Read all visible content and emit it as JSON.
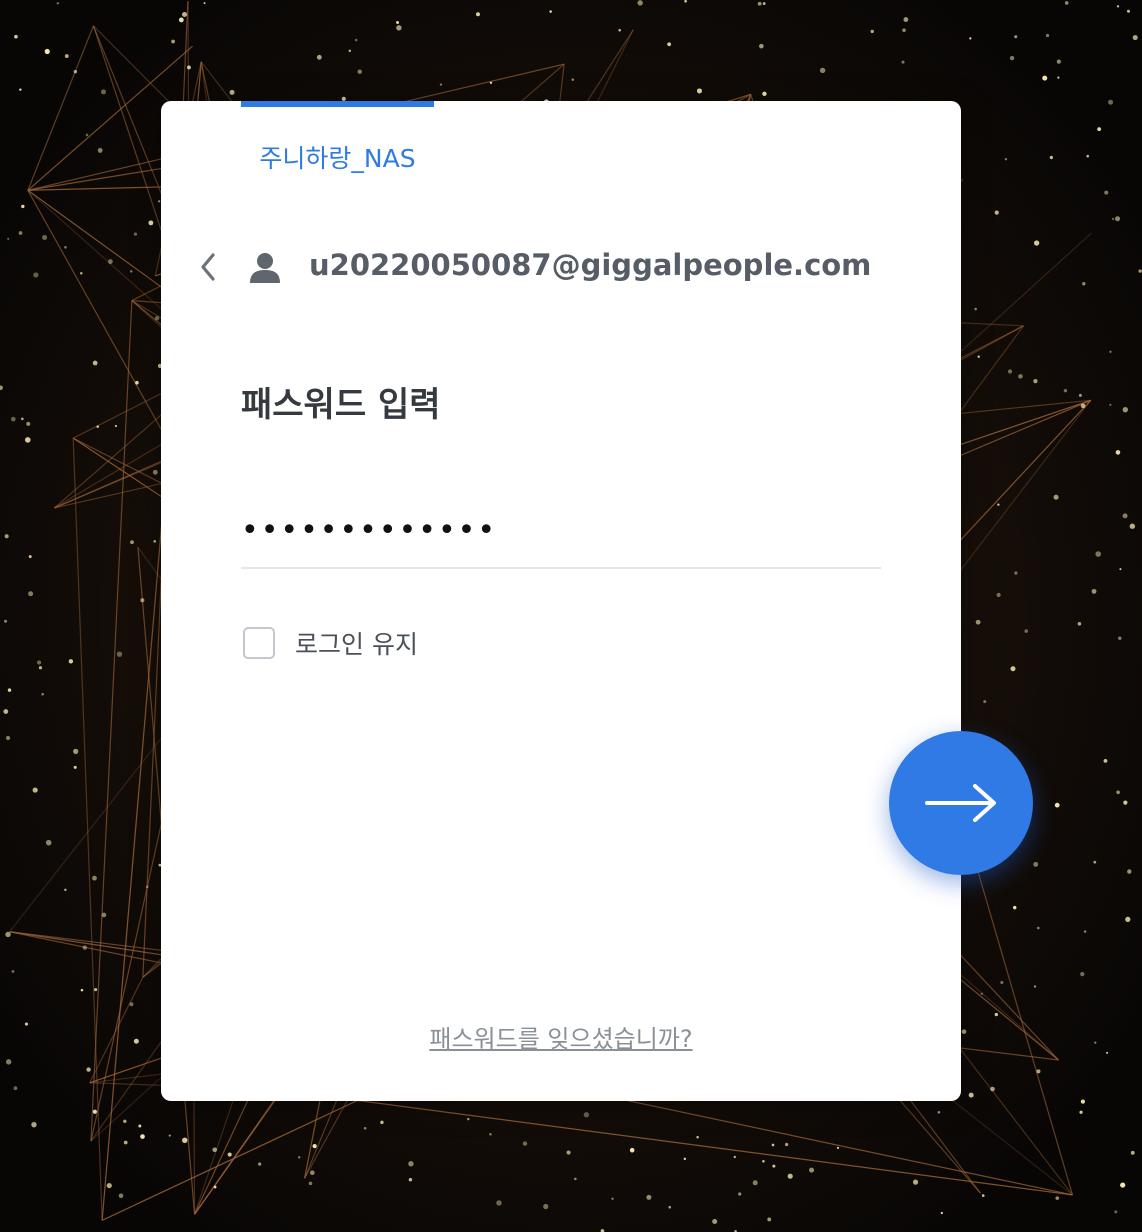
{
  "colors": {
    "accent": "#2f7ae5",
    "card": "#ffffff",
    "heading": "#343a40",
    "account_text": "#565d66",
    "muted_link": "#8a9098"
  },
  "tab": {
    "label": "주니하랑_NAS"
  },
  "account": {
    "back_icon": "chevron-left-icon",
    "user_icon": "user-icon",
    "username": "u20220050087@giggalpeople.com"
  },
  "password": {
    "heading": "패스워드 입력",
    "value": "•••••••••••••"
  },
  "remember": {
    "label": "로그인 유지",
    "checked": false
  },
  "submit": {
    "icon": "arrow-right-icon"
  },
  "forgot_link": "패스워드를 잊으셨습니까?"
}
